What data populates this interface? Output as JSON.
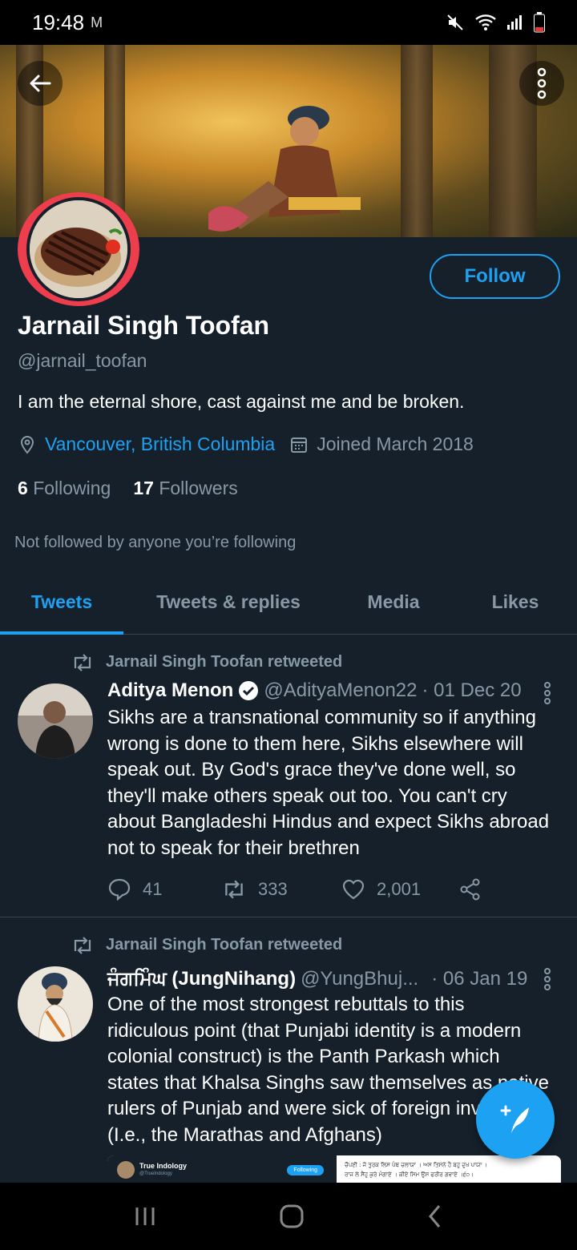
{
  "status_bar": {
    "time": "19:48",
    "sim_label": "M"
  },
  "profile": {
    "name": "Jarnail Singh Toofan",
    "handle": "@jarnail_toofan",
    "bio": "I am the eternal shore, cast against me and be broken.",
    "location": "Vancouver, British Columbia",
    "joined": "Joined March 2018",
    "following_count": "6",
    "following_label": "Following",
    "followers_count": "17",
    "followers_label": "Followers",
    "not_followed_note": "Not followed by anyone you’re following",
    "follow_label": "Follow"
  },
  "tabs": [
    {
      "label": "Tweets",
      "active": true
    },
    {
      "label": "Tweets & replies",
      "active": false
    },
    {
      "label": "Media",
      "active": false
    },
    {
      "label": "Likes",
      "active": false
    }
  ],
  "tweets": [
    {
      "retweeted_by": "Jarnail Singh Toofan retweeted",
      "author": "Aditya Menon",
      "verified": true,
      "username": "@AdityaMenon22",
      "date": "· 01 Dec 20",
      "lines": [
        "Sikhs are a transnational community so if anything",
        "wrong is done to them here, Sikhs elsewhere will",
        "speak out. By God's grace they've done well, so",
        "they'll make others speak out too. You can't cry",
        "about Bangladeshi Hindus and expect Sikhs abroad",
        "not to speak for their brethren"
      ],
      "replies": "41",
      "retweets": "333",
      "likes": "2,001"
    },
    {
      "retweeted_by": "Jarnail Singh Toofan retweeted",
      "author": "ਜੰਗਮਿੰਘ (JungNihang)",
      "verified": false,
      "username": "@YungBhuj...",
      "date": "· 06 Jan 19",
      "lines": [
        "One of the most strongest rebuttals to this",
        "ridiculous point (that Punjabi identity is a modern",
        "colonial construct) is the Panth Parkash which",
        "states that Khalsa Singhs saw themselves as native",
        "rulers of Punjab and were sick of foreign invaders",
        "(I.e., the Marathas and Afghans)"
      ]
    }
  ],
  "embed": {
    "account_name": "True Indology",
    "account_handle": "@TrueIndology",
    "following_badge": "Following",
    "quote_line1": "ਚੌਪਈ   : ਜੋ ਤੁਰਕ ਲਿਸ ਪੰਥ ਚਲਾਯਾ । ਅਸ ਤਿਸਨੇ ਹੈ ਬਹੁ ਦੁਖ ਪਾਯਾ ।",
    "quote_line2": "ਰਾਜ ਲੇ ਸੈਂਹੁ ਕੁਰੇ ਮੰਗਾਏ । ਕੀਏ ਸਿਮ ਉਸ ਫਰੀਰ ਗਵਾਏ ।੬੦।"
  },
  "colors": {
    "accent": "#1da1f2",
    "background": "#15202b",
    "secondary_text": "#8899a6",
    "divider": "#38444d",
    "avatar_ring": "#ee3e4e"
  },
  "icons": [
    "back-arrow-icon",
    "more-vertical-icon",
    "location-pin-icon",
    "calendar-icon",
    "retweet-icon",
    "verified-badge-icon",
    "reply-icon",
    "heart-icon",
    "share-icon",
    "compose-tweet-icon",
    "recent-apps-icon",
    "home-icon",
    "nav-back-icon",
    "wifi-icon",
    "signal-icon",
    "battery-icon",
    "mute-icon"
  ]
}
